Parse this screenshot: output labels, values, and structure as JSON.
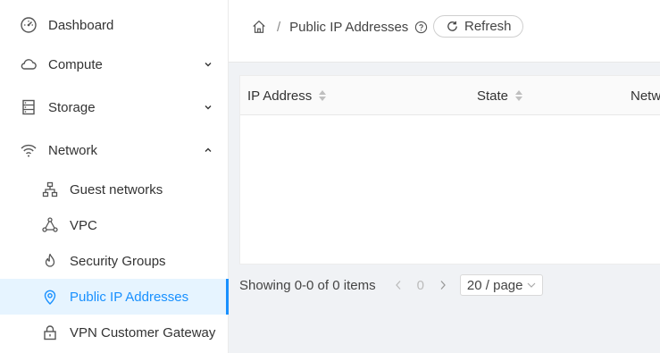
{
  "sidebar": {
    "items": [
      {
        "label": "Dashboard",
        "icon": "dashboard-icon"
      },
      {
        "label": "Compute",
        "icon": "cloud-icon"
      },
      {
        "label": "Storage",
        "icon": "storage-icon"
      },
      {
        "label": "Network",
        "icon": "wifi-icon"
      },
      {
        "label": "Guest networks",
        "icon": "network-tree-icon"
      },
      {
        "label": "VPC",
        "icon": "vpc-icon"
      },
      {
        "label": "Security Groups",
        "icon": "fire-icon"
      },
      {
        "label": "Public IP Addresses",
        "icon": "location-pin-icon"
      },
      {
        "label": "VPN Customer Gateway",
        "icon": "lock-icon"
      }
    ]
  },
  "header": {
    "breadcrumb_current": "Public IP Addresses",
    "refresh_label": "Refresh"
  },
  "table": {
    "columns": [
      "IP Address",
      "State",
      "Network"
    ]
  },
  "pagination": {
    "total_text": "Showing 0-0 of 0 items",
    "current_page": "0",
    "page_size": "20 / page"
  },
  "colors": {
    "accent": "#1890ff",
    "active_bg": "#e6f4ff"
  }
}
